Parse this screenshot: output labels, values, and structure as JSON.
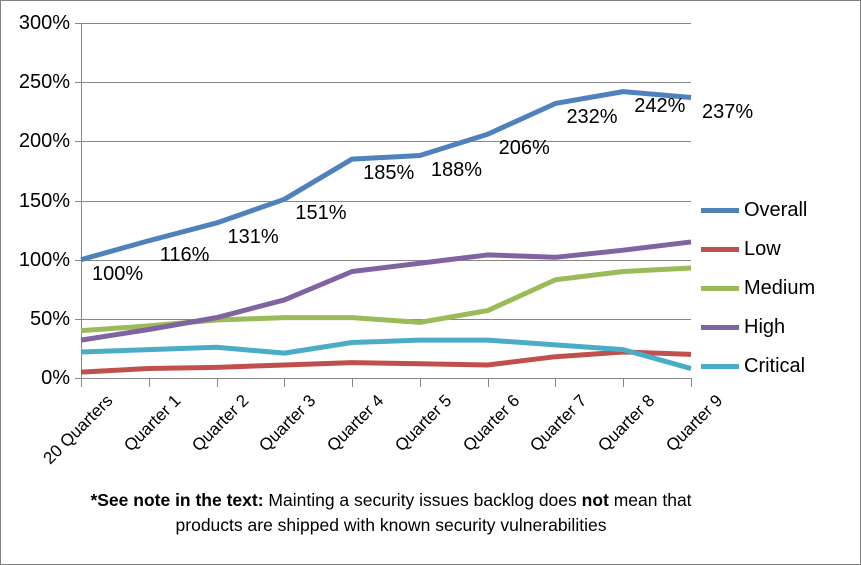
{
  "chart_data": {
    "type": "line",
    "title": "",
    "xlabel": "",
    "ylabel": "",
    "ylim": [
      0,
      300
    ],
    "y_tick_labels": [
      "0%",
      "50%",
      "100%",
      "150%",
      "200%",
      "250%",
      "300%"
    ],
    "y_ticks": [
      0,
      50,
      100,
      150,
      200,
      250,
      300
    ],
    "grid": true,
    "legend_position": "right",
    "categories": [
      "20 Quarters",
      "Quarter 1",
      "Quarter 2",
      "Quarter 3",
      "Quarter 4",
      "Quarter 5",
      "Quarter 6",
      "Quarter 7",
      "Quarter 8",
      "Quarter 9"
    ],
    "series": [
      {
        "name": "Overall",
        "color": "#4F81BD",
        "values": [
          100,
          116,
          131,
          151,
          185,
          188,
          206,
          232,
          242,
          237
        ],
        "data_labels": [
          "100%",
          "116%",
          "131%",
          "151%",
          "185%",
          "188%",
          "206%",
          "232%",
          "242%",
          "237%"
        ]
      },
      {
        "name": "Low",
        "color": "#C0504D",
        "values": [
          5,
          8,
          9,
          11,
          13,
          12,
          11,
          18,
          22,
          20
        ],
        "data_labels": []
      },
      {
        "name": "Medium",
        "color": "#9BBB59",
        "values": [
          40,
          44,
          49,
          51,
          51,
          47,
          57,
          83,
          90,
          93
        ],
        "data_labels": []
      },
      {
        "name": "High",
        "color": "#8064A2",
        "values": [
          32,
          41,
          51,
          66,
          90,
          97,
          104,
          102,
          108,
          115
        ],
        "data_labels": []
      },
      {
        "name": "Critical",
        "color": "#4BACC6",
        "values": [
          22,
          24,
          26,
          21,
          30,
          32,
          32,
          28,
          24,
          8
        ],
        "data_labels": []
      }
    ]
  },
  "legend": {
    "items": [
      {
        "label": "Overall",
        "color": "#4F81BD"
      },
      {
        "label": "Low",
        "color": "#C0504D"
      },
      {
        "label": "Medium",
        "color": "#9BBB59"
      },
      {
        "label": "High",
        "color": "#8064A2"
      },
      {
        "label": "Critical",
        "color": "#4BACC6"
      }
    ]
  },
  "footnote": {
    "lead": "*See note in the text:",
    "middle": " Mainting a security issues backlog does ",
    "emphasis": "not",
    "tail": " mean that products are shipped with known security vulnerabilities"
  }
}
